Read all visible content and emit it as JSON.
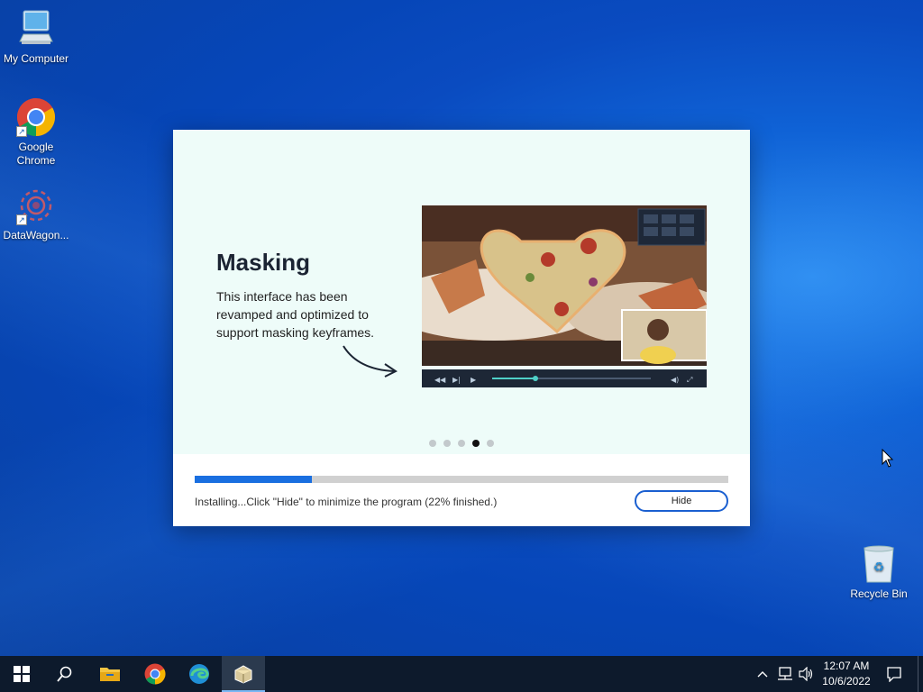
{
  "desktop": {
    "icons": [
      {
        "label": "My Computer"
      },
      {
        "label": "Google Chrome"
      },
      {
        "label": "DataWagon..."
      },
      {
        "label": "Recycle Bin"
      }
    ]
  },
  "installer": {
    "slide": {
      "title": "Masking",
      "description": "This interface has been revamped and optimized to support masking keyframes.",
      "page_count": 5,
      "active_page": 4
    },
    "progress_fraction": 0.22,
    "status_text": "Installing...Click \"Hide\" to minimize the program (22% finished.)",
    "hide_label": "Hide"
  },
  "taskbar": {
    "items": [
      "windows-start-icon",
      "search-icon",
      "file-explorer-icon",
      "chrome-icon",
      "edge-icon",
      "installer-app-icon"
    ],
    "active_item": "installer-app-icon",
    "tray_icons": [
      "chevron-up-icon",
      "network-icon",
      "volume-icon",
      "notification-icon"
    ],
    "time": "12:07 AM",
    "date": "10/6/2022"
  },
  "colors": {
    "accent": "#1a6fe0",
    "slide_bg": "#eefcf9",
    "taskbar_bg": "#0d1a2c"
  }
}
